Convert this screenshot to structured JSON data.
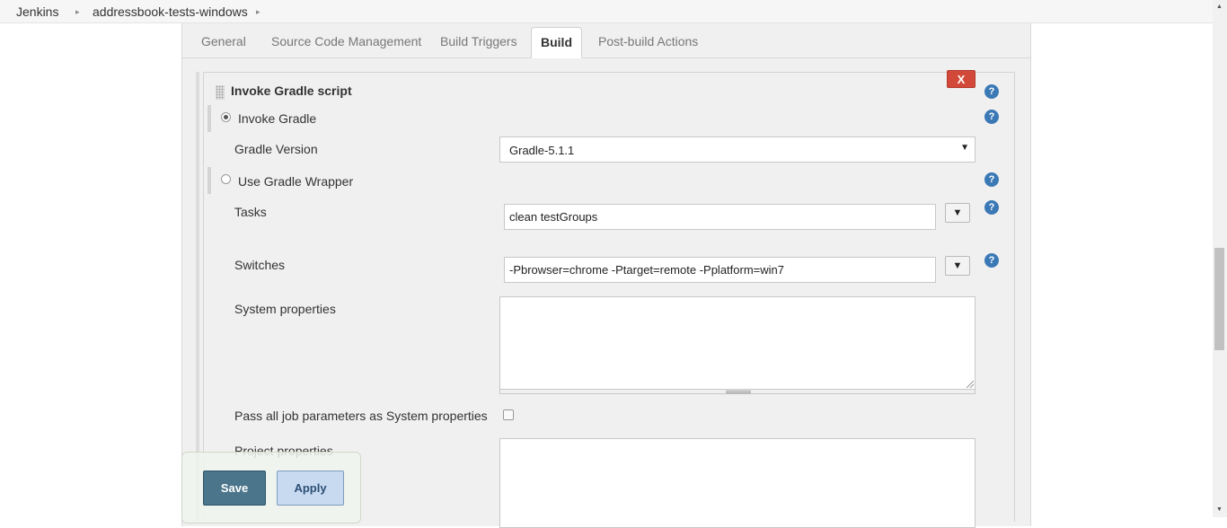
{
  "breadcrumb": {
    "items": [
      "Jenkins",
      "addressbook-tests-windows"
    ],
    "separator": "▸"
  },
  "tabs": [
    {
      "label": "General"
    },
    {
      "label": "Source Code Management"
    },
    {
      "label": "Build Triggers"
    },
    {
      "label": "Build",
      "active": true
    },
    {
      "label": "Post-build Actions"
    }
  ],
  "step": {
    "title": "Invoke Gradle script",
    "delete_label": "X",
    "help_glyph": "?"
  },
  "options": {
    "invoke_gradle": {
      "label": "Invoke Gradle",
      "selected": true
    },
    "use_wrapper": {
      "label": "Use Gradle Wrapper",
      "selected": false
    }
  },
  "fields": {
    "gradle_version": {
      "label": "Gradle Version",
      "value": "Gradle-5.1.1"
    },
    "tasks": {
      "label": "Tasks",
      "value": "clean testGroups"
    },
    "switches": {
      "label": "Switches",
      "value": "-Pbrowser=chrome -Ptarget=remote -Pplatform=win7"
    },
    "system_properties": {
      "label": "System properties",
      "value": ""
    },
    "pass_params": {
      "label": "Pass all job parameters as System properties",
      "checked": false
    },
    "project_properties": {
      "label": "Project properties",
      "value": ""
    }
  },
  "expand_glyph": "▼",
  "select_arrow": "▼",
  "actions": {
    "save": "Save",
    "apply": "Apply"
  },
  "scroll": {
    "up": "▲",
    "down": "▼"
  },
  "colors": {
    "save": "#4b758b",
    "apply": "#c8daf0",
    "delete": "#d24939",
    "help": "#3b79b6"
  }
}
